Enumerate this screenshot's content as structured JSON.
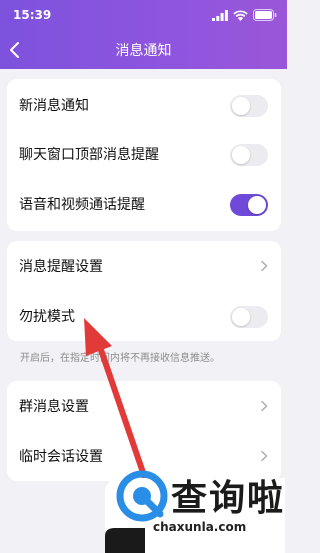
{
  "status_bar": {
    "time": "15:39"
  },
  "nav": {
    "title": "消息通知"
  },
  "group1": [
    {
      "label": "新消息通知",
      "on": false
    },
    {
      "label": "聊天窗口顶部消息提醒",
      "on": false
    },
    {
      "label": "语音和视频通话提醒",
      "on": true
    }
  ],
  "group2": {
    "reminder_settings": "消息提醒设置",
    "dnd": {
      "label": "勿扰模式",
      "on": false
    }
  },
  "dnd_hint": "开启后，在指定时间内将不再接收信息推送。",
  "group3": [
    {
      "label": "群消息设置"
    },
    {
      "label": "临时会话设置"
    }
  ],
  "watermark": {
    "brand": "查询啦",
    "url": "chaxunla.com"
  },
  "colors": {
    "header": "#8352dd",
    "toggle_on": "#6f4ad8",
    "arrow": "#e23a38",
    "watermark_blue": "#2a8ee6"
  }
}
